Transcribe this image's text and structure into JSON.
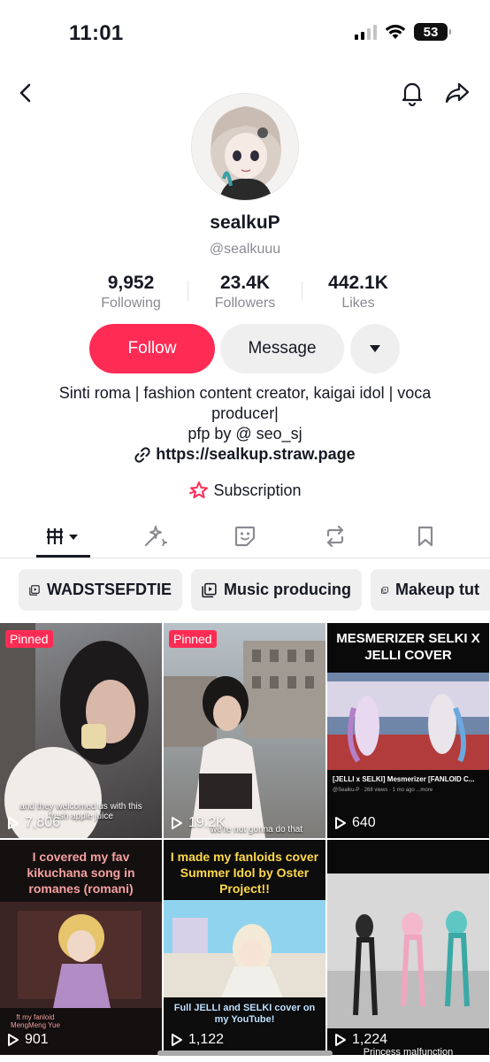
{
  "status_bar": {
    "time": "11:01",
    "battery": "53"
  },
  "profile": {
    "username": "sealkuP",
    "handle": "@sealkuuu",
    "stats": [
      {
        "value": "9,952",
        "label": "Following"
      },
      {
        "value": "23.4K",
        "label": "Followers"
      },
      {
        "value": "442.1K",
        "label": "Likes"
      }
    ],
    "follow_label": "Follow",
    "message_label": "Message",
    "bio_line1": "Sinti roma | fashion content creator, kaigai idol | voca producer|",
    "bio_line2": "pfp by @ seo_sj",
    "link": "https://sealkup.straw.page",
    "subscription": "Subscription"
  },
  "playlists": [
    "WADSTSEFDTIE",
    "Music producing",
    "Makeup tut"
  ],
  "videos": [
    {
      "pinned": "Pinned",
      "views": "7,806",
      "caption": "and they welcomed us with this fresh apple juice"
    },
    {
      "pinned": "Pinned",
      "views": "19.2K",
      "caption": "we're not gonna do that"
    },
    {
      "views": "640",
      "title": "MESMERIZER SELKI X JELLI COVER",
      "caption": "[JELLI x SELKI] Mesmerizer [FANLOID C...",
      "meta": "@Sealku-P · 268 views · 1 mo ago ...more"
    },
    {
      "views": "901",
      "title": "I covered my fav kikuchana song in romanes (romani)",
      "caption": "ft my fanloid MengMeng Yue"
    },
    {
      "views": "1,122",
      "title": "I made my fanloids cover Summer Idol by Oster Project!!",
      "caption": "Full JELLI and SELKI cover on my YouTube!"
    },
    {
      "views": "1,224",
      "caption": "Princess malfunction"
    }
  ],
  "colors": {
    "accent": "#fe2c55",
    "text": "#161823",
    "muted": "#8a8b91",
    "chip_bg": "#efefef"
  }
}
